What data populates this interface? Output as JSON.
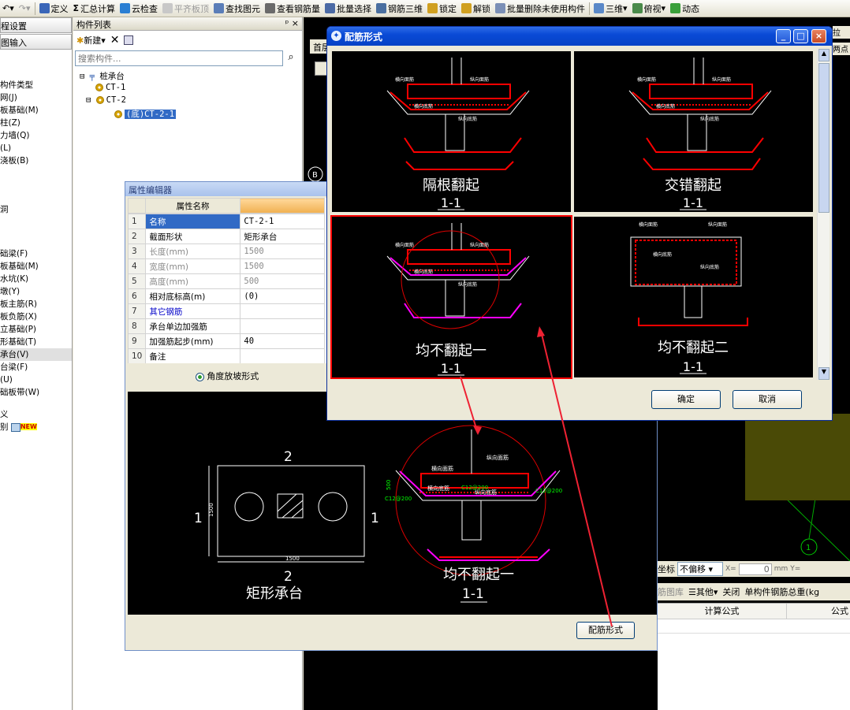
{
  "toolbar": {
    "items": [
      {
        "label": "定义",
        "icon": "define-icon"
      },
      {
        "label": "汇总计算",
        "icon": "sigma-icon"
      },
      {
        "label": "云检查",
        "icon": "cloud-check-icon"
      },
      {
        "label": "平齐板顶",
        "icon": "align-icon"
      },
      {
        "label": "查找图元",
        "icon": "find-icon"
      },
      {
        "label": "查看钢筋量",
        "icon": "view-rebar-icon"
      },
      {
        "label": "批量选择",
        "icon": "batch-select-icon"
      },
      {
        "label": "钢筋三维",
        "icon": "rebar-3d-icon"
      },
      {
        "label": "锁定",
        "icon": "lock-icon"
      },
      {
        "label": "解锁",
        "icon": "unlock-icon"
      },
      {
        "label": "批量删除未使用构件",
        "icon": "batch-delete-icon"
      },
      {
        "label": "三维",
        "icon": "3d-icon"
      },
      {
        "label": "俯视",
        "icon": "top-view-icon"
      },
      {
        "label": "动态",
        "icon": "dynamic-icon"
      }
    ]
  },
  "left_panel": {
    "buttons": [
      "程设置",
      "图输入"
    ],
    "rows_top": [
      "构件类型",
      "网(J)",
      "板基础(M)",
      "柱(Z)",
      "力墙(Q)",
      "(L)",
      "浇板(B)"
    ],
    "row_mid": "洞",
    "rows_bottom": [
      "础梁(F)",
      "板基础(M)",
      "水坑(K)",
      "墩(Y)",
      "板主筋(R)",
      "板负筋(X)",
      "立基础(P)",
      "形基础(T)",
      "承台(V)",
      "台梁(F)",
      "(U)",
      "础板带(W)"
    ],
    "row_end1": "义",
    "row_end2": "别",
    "new_badge": "NEW"
  },
  "component_list": {
    "title": "构件列表",
    "pin": "ᵖ",
    "close": "×",
    "new_label": "新建",
    "search_placeholder": "搜索构件...",
    "tree": {
      "root": "桩承台",
      "children": [
        "CT-1",
        "CT-2"
      ],
      "grandchild": "(底)CT-2-1"
    }
  },
  "canvas": {
    "tab_first": "首层",
    "tab_right1": "拉",
    "tab_right2": "两点",
    "marker_b": "B",
    "marker_1": "1",
    "coord_label": "坐标",
    "offset_value": "不偏移",
    "x_label": "X=",
    "x_value": "0",
    "unit": "mm",
    "y_label": "Y=",
    "toolbar2": [
      "筋图库",
      "其他",
      "关闭",
      "单构件钢筋总重(kg"
    ],
    "col1": "计算公式",
    "col2": "公式"
  },
  "property_editor": {
    "title": "属性编辑器",
    "header": "属性名称",
    "rows": [
      {
        "num": "1",
        "name": "名称",
        "value": "CT-2-1"
      },
      {
        "num": "2",
        "name": "截面形状",
        "value": "矩形承台"
      },
      {
        "num": "3",
        "name": "长度(mm)",
        "value": "1500"
      },
      {
        "num": "4",
        "name": "宽度(mm)",
        "value": "1500"
      },
      {
        "num": "5",
        "name": "高度(mm)",
        "value": "500"
      },
      {
        "num": "6",
        "name": "相对底标高(m)",
        "value": "(0)"
      },
      {
        "num": "7",
        "name": "其它钢筋",
        "value": ""
      },
      {
        "num": "8",
        "name": "承台单边加强筋",
        "value": ""
      },
      {
        "num": "9",
        "name": "加强筋起步(mm)",
        "value": "40"
      },
      {
        "num": "10",
        "name": "备注",
        "value": ""
      }
    ],
    "radio_label": "角度放坡形式",
    "plan_title": "矩形承台",
    "plan_dim_w": "1500",
    "plan_dim_h": "1500",
    "plan_cut1": "1",
    "plan_cut2": "2",
    "section_title": "均不翻起一",
    "section_sub": "1-1",
    "rebar_button": "配筋形式",
    "sec_labels": {
      "a": "横向面筋",
      "b": "纵向面筋",
      "c": "横向底筋",
      "d": "纵向底筋",
      "e": "C12@200",
      "f": "500"
    }
  },
  "dialog": {
    "title": "配筋形式",
    "min": "_",
    "max": "□",
    "close": "×",
    "tiles": [
      {
        "title": "隔根翻起",
        "sub": "1-1"
      },
      {
        "title": "交错翻起",
        "sub": "1-1"
      },
      {
        "title": "均不翻起一",
        "sub": "1-1"
      },
      {
        "title": "均不翻起二",
        "sub": "1-1"
      }
    ],
    "labels": {
      "tm": "横向面筋",
      "lm": "纵向面筋",
      "td": "横向底筋",
      "ld": "纵向底筋"
    },
    "ok": "确定",
    "cancel": "取消"
  }
}
